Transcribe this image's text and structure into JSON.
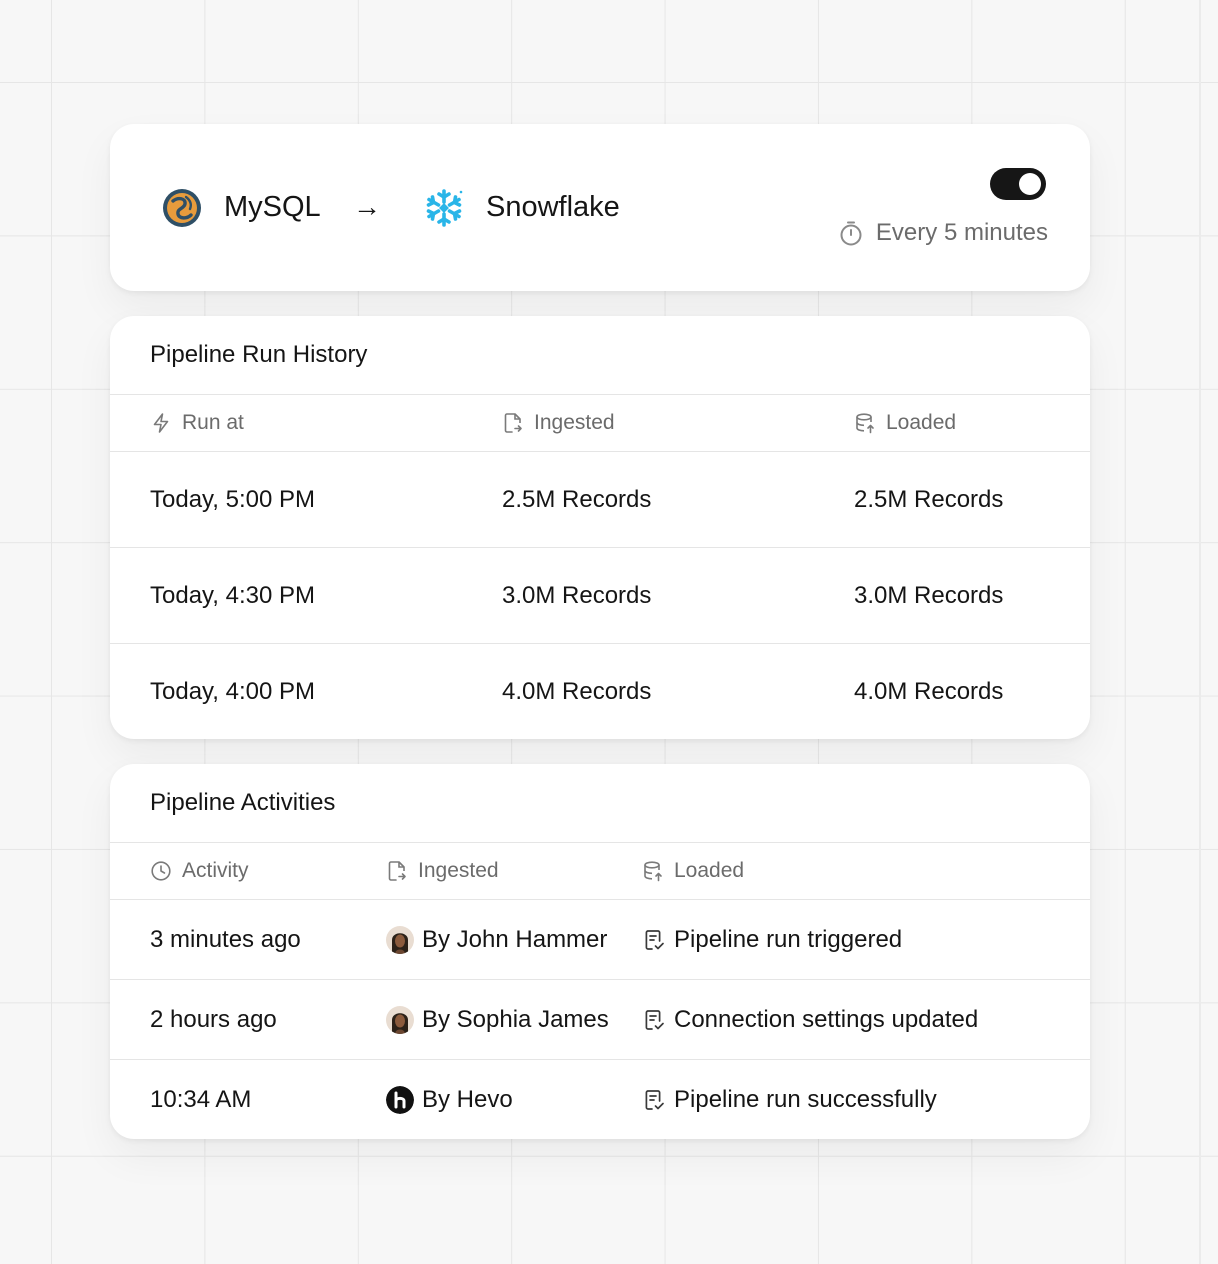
{
  "connection": {
    "source": {
      "name": "MySQL",
      "icon": "mysql-logo-icon"
    },
    "arrow": "→",
    "destination": {
      "name": "Snowflake",
      "icon": "snowflake-logo-icon"
    },
    "enabled": true,
    "schedule": "Every 5 minutes"
  },
  "run_history": {
    "title": "Pipeline Run History",
    "columns": [
      {
        "label": "Run at",
        "icon": "lightning-icon"
      },
      {
        "label": "Ingested",
        "icon": "file-arrow-icon"
      },
      {
        "label": "Loaded",
        "icon": "database-upload-icon"
      }
    ],
    "rows": [
      {
        "run_at": "Today, 5:00 PM",
        "ingested": "2.5M Records",
        "loaded": "2.5M Records"
      },
      {
        "run_at": "Today, 4:30 PM",
        "ingested": "3.0M Records",
        "loaded": "3.0M Records"
      },
      {
        "run_at": "Today, 4:00 PM",
        "ingested": "4.0M Records",
        "loaded": "4.0M Records"
      }
    ]
  },
  "activities": {
    "title": "Pipeline Activities",
    "columns": [
      {
        "label": "Activity",
        "icon": "clock-icon"
      },
      {
        "label": "Ingested",
        "icon": "file-arrow-icon"
      },
      {
        "label": "Loaded",
        "icon": "database-upload-icon"
      }
    ],
    "rows": [
      {
        "time": "3 minutes ago",
        "actor": "By John Hammer",
        "actor_icon": "user-avatar",
        "event": "Pipeline run triggered"
      },
      {
        "time": "2 hours ago",
        "actor": "By Sophia James",
        "actor_icon": "user-avatar",
        "event": "Connection settings updated"
      },
      {
        "time": "10:34 AM",
        "actor": "By Hevo",
        "actor_icon": "hevo-logo-icon",
        "event": "Pipeline run successfully"
      }
    ]
  },
  "colors": {
    "background": "#f7f7f7",
    "card": "#ffffff",
    "toggle_on": "#161616",
    "muted_text": "#6b6b6b",
    "snowflake_blue": "#29b5e8"
  }
}
